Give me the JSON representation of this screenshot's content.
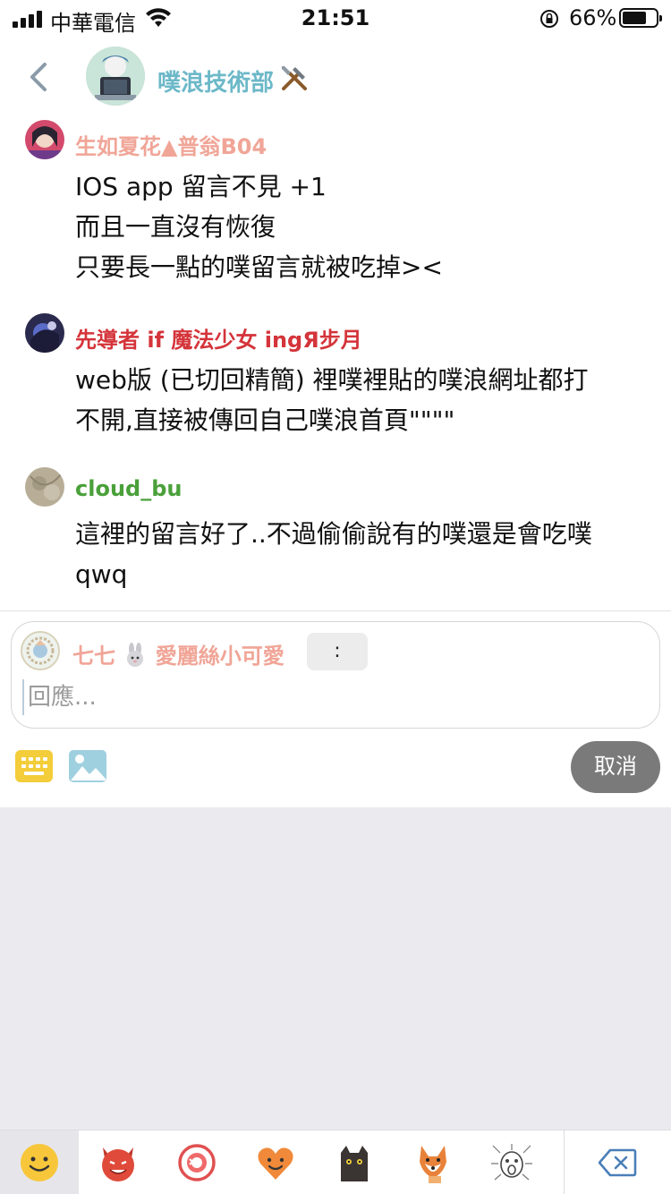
{
  "status_bar": {
    "carrier": "中華電信",
    "time": "21:51",
    "battery_percent": "66%"
  },
  "header": {
    "title": "噗浪技術部",
    "back_icon": "chevron-left-icon",
    "title_emoji": "🛠️"
  },
  "comments": [
    {
      "name": "生如夏花▲普翁B04",
      "name_color": "#f0a597",
      "lines": [
        "IOS app 留言不見 +1",
        "而且一直沒有恢復",
        "只要長一點的噗留言就被吃掉><"
      ]
    },
    {
      "name": "先導者 if 魔法少女 ingЯ步月",
      "name_color": "#d4343a",
      "lines": [
        "web版 (已切回精簡) 裡噗裡貼的噗浪網址都打",
        "不開,直接被傳回自己噗浪首頁\"\"\"\""
      ]
    },
    {
      "name": "cloud_bu",
      "name_color": "#4aa03a",
      "lines": [
        "這裡的留言好了..不過偷偷說有的噗還是會吃噗",
        "qwq"
      ]
    }
  ],
  "reply": {
    "user_name_prefix": "七七",
    "user_name_suffix": "愛麗絲小可愛",
    "qualifier": ":",
    "placeholder": "回應...",
    "cancel_label": "取消"
  },
  "toolbar": {
    "keyboard_icon": "keyboard-icon",
    "image_icon": "image-icon"
  },
  "emoji_tabs": [
    "smiley-face-icon",
    "devil-face-icon",
    "karma-icon",
    "heart-face-icon",
    "black-cat-icon",
    "fox-icon",
    "shocked-sketch-icon"
  ],
  "delete_icon": "backspace-icon",
  "colors": {
    "header_title": "#6cb8c8",
    "cancel_bg": "#7a7a7a",
    "panel_bg": "#ebebef"
  }
}
